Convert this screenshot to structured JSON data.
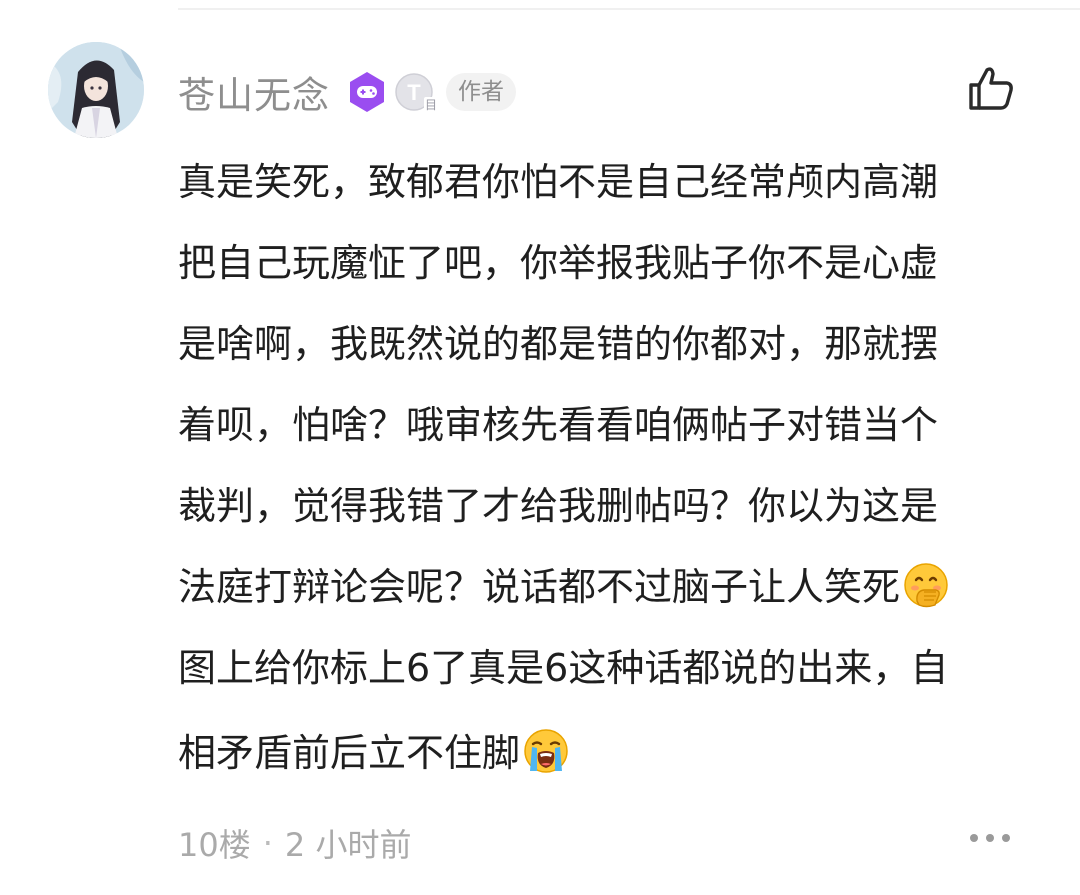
{
  "comment": {
    "author": {
      "name": "苍山无念",
      "level_badge": "T",
      "level_badge_sub": "目",
      "author_tag": "作者"
    },
    "body_lines": [
      "真是笑死，致郁君你怕不是自己经常颅内高潮",
      "把自己玩魔怔了吧，你举报我贴子你不是心虚",
      "是啥啊，我既然说的都是错的你都对，那就摆",
      "着呗，怕啥？哦审核先看看咱俩帖子对错当个",
      "裁判，觉得我错了才给我删帖吗？你以为这是",
      "法庭打辩论会呢？说话都不过脑子让人笑死",
      "图上给你标上6了真是6这种话都说的出来，自",
      "相矛盾前后立不住脚"
    ],
    "floor": "10楼",
    "separator": "·",
    "time": "2 小时前"
  },
  "icons": {
    "like": "thumbs-up-icon",
    "more": "more-dots-icon",
    "game_badge": "gamepad-icon",
    "emoji_1": "hand-over-mouth-emoji",
    "emoji_2": "loudly-crying-emoji"
  },
  "colors": {
    "game_badge": "#9a4df0",
    "muted_text": "#8e8e8e",
    "body_text": "#1f1f1f",
    "tag_bg": "#f2f2f2"
  }
}
